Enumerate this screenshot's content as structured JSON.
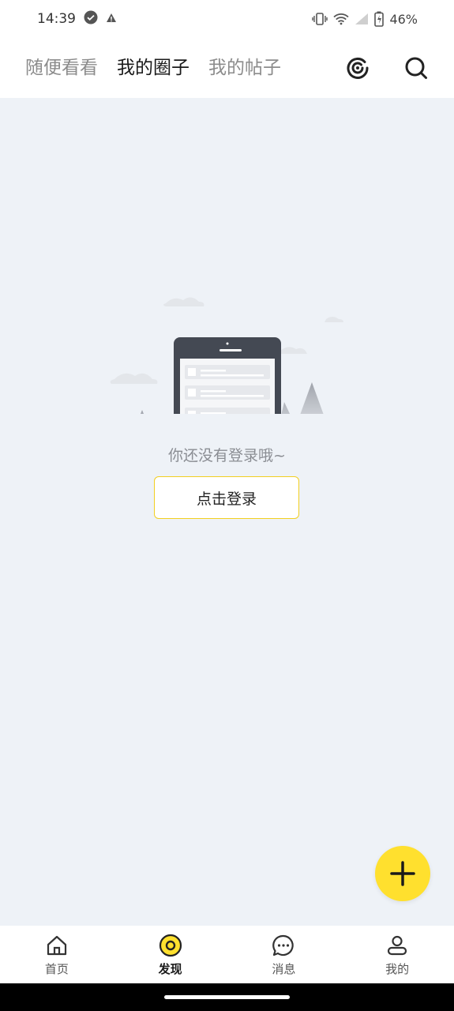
{
  "status_bar": {
    "time": "14:39",
    "battery": "46%",
    "icons": [
      "check-circle-icon",
      "alert-icon",
      "vibrate-icon",
      "wifi-icon",
      "signal-icon",
      "battery-icon"
    ]
  },
  "tabs": [
    {
      "label": "随便看看",
      "active": false
    },
    {
      "label": "我的圈子",
      "active": true
    },
    {
      "label": "我的帖子",
      "active": false
    }
  ],
  "header_actions": [
    "checkin-icon",
    "search-icon"
  ],
  "empty_state": {
    "message": "你还没有登录哦~",
    "login_label": "点击登录"
  },
  "fab": {
    "icon": "plus-icon"
  },
  "bottom_nav": [
    {
      "label": "首页",
      "icon": "home-icon",
      "active": false
    },
    {
      "label": "发现",
      "icon": "discover-icon",
      "active": true
    },
    {
      "label": "消息",
      "icon": "message-icon",
      "active": false
    },
    {
      "label": "我的",
      "icon": "profile-icon",
      "active": false
    }
  ],
  "colors": {
    "accent": "#ffe02e",
    "tab_underline": "#ffe34d",
    "background": "#eef2f7",
    "button_border": "#f2cf20"
  }
}
